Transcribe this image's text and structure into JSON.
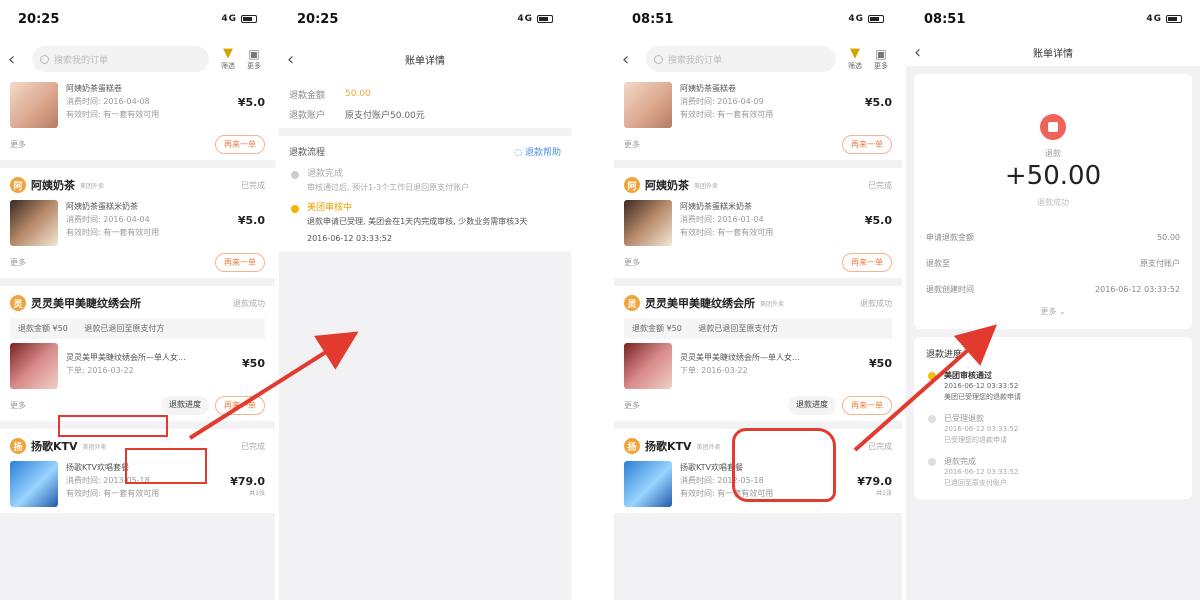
{
  "colors": {
    "red_annotation": "#e23a2e",
    "orange": "#f07b3f",
    "gold": "#f0a43a",
    "link_blue": "#4a90e2"
  },
  "icons": [
    "back-arrow-icon",
    "search-icon",
    "filter-icon",
    "calendar-icon",
    "refund-icon",
    "signal-icon",
    "battery-icon"
  ],
  "screen1": {
    "time": "20:25",
    "signal": "4G",
    "search_placeholder": "搜索我的订单",
    "tool_filter": "筛选",
    "tool_cal": "更多",
    "orders": [
      {
        "shop": "",
        "item": "阿姨奶茶蛋糕卷",
        "date": "消费时间: 2016-04-08",
        "note": "有效时间: 有一套有效可用",
        "price": "¥5.0",
        "more": "更多",
        "btn": "再来一单"
      },
      {
        "shop": "阿姨奶茶",
        "tag": "美团外卖",
        "status": "已完成",
        "item": "阿姨奶茶蛋糕米奶茶",
        "date": "消费时间: 2016-04-04",
        "note": "有效时间: 有一套有效可用",
        "price": "¥5.0",
        "more": "更多",
        "btn": "再来一单"
      },
      {
        "shop": "灵灵美甲美睫纹绣会所",
        "status": "退款成功",
        "refund_amount": "退款金额 ¥50",
        "refund_note": "退款已退回至原支付方",
        "item": "灵灵美甲美睫纹绣会所—单人女...",
        "date": "下单: 2016-03-22",
        "price": "¥50",
        "more": "更多",
        "btn_refund": "退款进度",
        "btn": "再来一单"
      },
      {
        "shop": "扬歌KTV",
        "tag": "美团外卖",
        "status": "已完成",
        "item": "扬歌KTV欢唱套餐",
        "date": "消费时间: 2013-05-18",
        "note": "有效时间: 有一套有效可用",
        "price": "¥79.0",
        "price_note": "共1张",
        "more": "更多"
      }
    ]
  },
  "screen2": {
    "time": "20:25",
    "signal": "4G",
    "title": "账单详情",
    "refund_amount_label": "退款金额",
    "refund_amount_value": "50.00",
    "refund_account_label": "退款账户",
    "refund_account_value": "原支付账户50.00元",
    "flow_label": "退款流程",
    "flow_link": "退款帮助",
    "steps": [
      {
        "title": "退款完成",
        "desc": "审核通过后, 预计1-3个工作日退回原支付账户"
      },
      {
        "title": "美团审核中",
        "desc": "退款申请已受理, 美团会在1天内完成审核, 少数业务需审核3天",
        "time": "2016-06-12 03:33:52"
      }
    ]
  },
  "screen3": {
    "time": "08:51",
    "signal": "4G",
    "search_placeholder": "搜索我的订单",
    "tool_filter": "筛选",
    "tool_cal": "更多",
    "orders": [
      {
        "shop": "",
        "item": "阿姨奶茶蛋糕卷",
        "date": "消费时间: 2016-04-09",
        "note": "有效时间: 有一套有效可用",
        "price": "¥5.0",
        "more": "更多",
        "btn": "再来一单"
      },
      {
        "shop": "阿姨奶茶",
        "tag": "美团外卖",
        "status": "已完成",
        "item": "阿姨奶茶蛋糕米奶茶",
        "date": "消费时间: 2016-01-04",
        "note": "有效时间: 有一套有效可用",
        "price": "¥5.0",
        "more": "更多",
        "btn": "再来一单"
      },
      {
        "shop": "灵灵美甲美睫纹绣会所",
        "tag": "美团外卖",
        "status": "退款成功",
        "refund_amount": "退款金额 ¥50",
        "refund_note": "退款已退回至原支付方",
        "item": "灵灵美甲美睫纹绣会所—单人女...",
        "date": "下单: 2016-03-22",
        "price": "¥50",
        "more": "更多",
        "btn_refund": "退款进度",
        "btn": "再来一单"
      },
      {
        "shop": "扬歌KTV",
        "tag": "美团外卖",
        "status": "已完成",
        "item": "扬歌KTV欢唱套餐",
        "date": "消费时间: 2012-05-18",
        "note": "有效时间: 有一套有效可用",
        "price": "¥79.0",
        "price_note": "共1张",
        "more": "更多"
      }
    ]
  },
  "screen4": {
    "time": "08:51",
    "signal": "4G",
    "title": "账单详情",
    "label": "退款",
    "amount": "+50.00",
    "sub": "退款成功",
    "rows": [
      {
        "k": "申请退款金额",
        "v": "50.00"
      },
      {
        "k": "退款至",
        "v": "原支付账户"
      },
      {
        "k": "退款创建时间",
        "v": "2016-06-12 03:33:52"
      }
    ],
    "more": "更多",
    "progress_title": "退款进度",
    "steps": [
      {
        "title": "美团审核通过",
        "time": "2016-06-12 03:33:52",
        "desc": "美团已受理您的退款申请"
      },
      {
        "title": "已受理退款",
        "time": "2016-06-12 03:33:52",
        "desc": "已受理您的退款申请"
      },
      {
        "title": "退款完成",
        "time": "2016-06-12 03:33:52",
        "desc": "已退回至原支付账户"
      }
    ]
  }
}
